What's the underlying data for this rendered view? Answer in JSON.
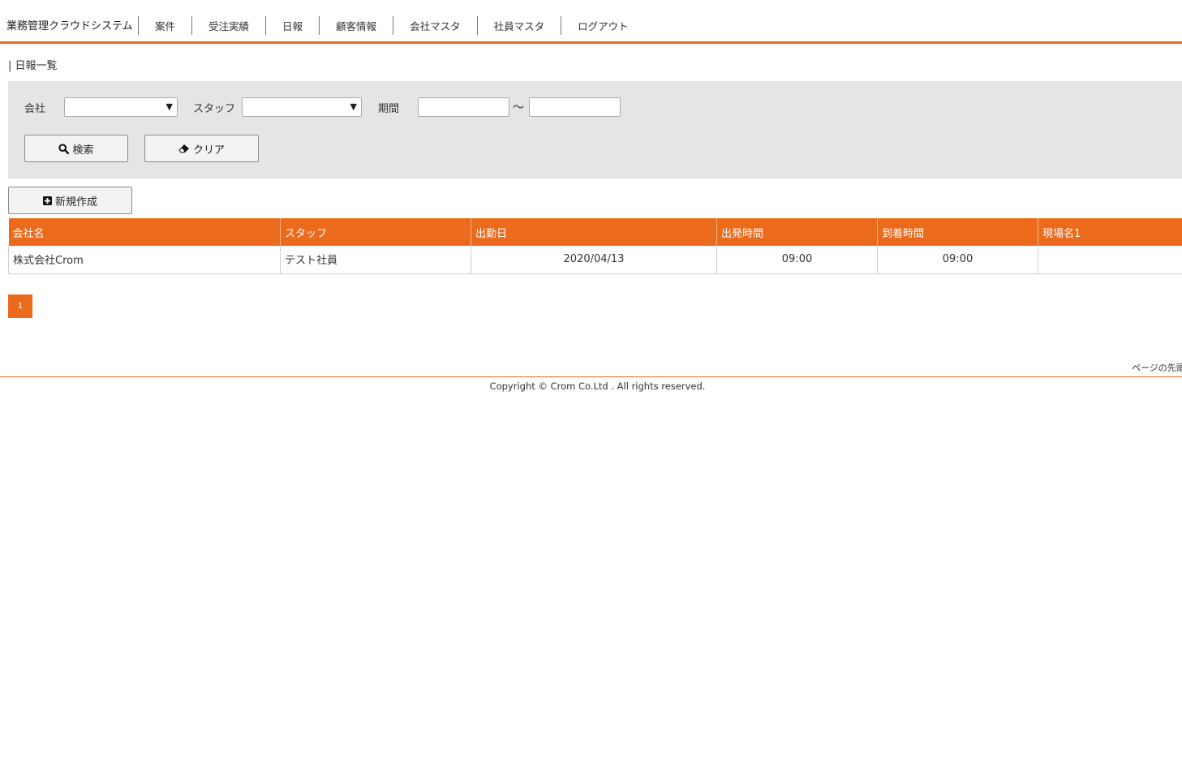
{
  "app_title": "業務管理クラウドシステム",
  "nav": [
    "案件",
    "受注実績",
    "日報",
    "顧客情報",
    "会社マスタ",
    "社員マスタ",
    "ログアウト"
  ],
  "page_title": "| 日報一覧",
  "search": {
    "company_label": "会社",
    "company_value": "",
    "staff_label": "スタッフ",
    "staff_value": "",
    "period_label": "期間",
    "period_from": "",
    "period_to": "",
    "tilde": "～",
    "search_button": "検索",
    "clear_button": "クリア"
  },
  "new_button": "新規作成",
  "table": {
    "headers": [
      "会社名",
      "スタッフ",
      "出勤日",
      "出発時間",
      "到着時間",
      "現場名1"
    ],
    "rows": [
      [
        "株式会社Crom",
        "テスト社員",
        "2020/04/13",
        "09:00",
        "09:00",
        ""
      ]
    ]
  },
  "pagination": {
    "current": "1"
  },
  "footer": {
    "to_top": "ページの先頭",
    "copyright": "Copyright © Crom Co.Ltd . All rights reserved."
  },
  "colors": {
    "accent": "#ec6a1c",
    "panel": "#e5e5e5"
  }
}
